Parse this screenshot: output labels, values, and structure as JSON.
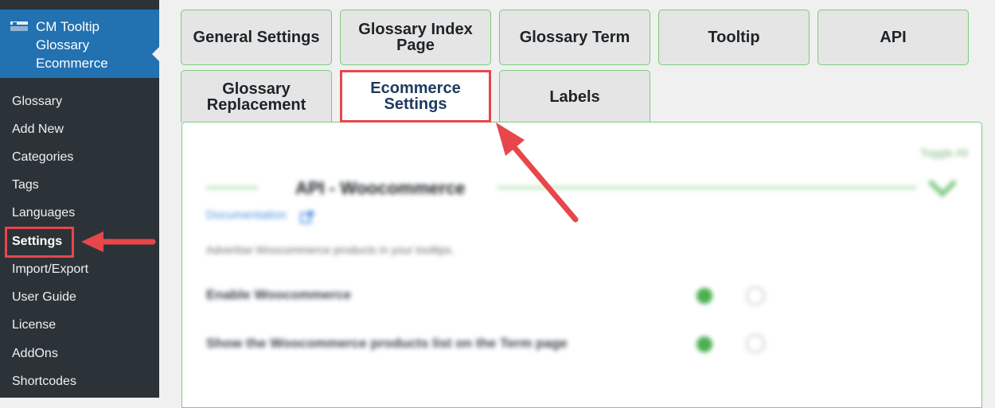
{
  "sidebar": {
    "plugin_title_lines": [
      "CM Tooltip",
      "Glossary",
      "Ecommerce"
    ],
    "items": [
      {
        "label": "Glossary",
        "current": false
      },
      {
        "label": "Add New",
        "current": false
      },
      {
        "label": "Categories",
        "current": false
      },
      {
        "label": "Tags",
        "current": false
      },
      {
        "label": "Languages",
        "current": false
      },
      {
        "label": "Settings",
        "current": true
      },
      {
        "label": "Import/Export",
        "current": false
      },
      {
        "label": "User Guide",
        "current": false
      },
      {
        "label": "License",
        "current": false
      },
      {
        "label": "AddOns",
        "current": false
      },
      {
        "label": "Shortcodes",
        "current": false
      }
    ]
  },
  "tabs": {
    "general_settings": "General Settings",
    "glossary_index_page": "Glossary Index Page",
    "glossary_term": "Glossary Term",
    "tooltip": "Tooltip",
    "api": "API",
    "glossary_replacement": "Glossary Replacement",
    "ecommerce_settings": "Ecommerce Settings",
    "labels": "Labels",
    "active": "Ecommerce Settings"
  },
  "panel": {
    "toggle_all": "Toggle All",
    "section_title": "API - Woocommerce",
    "documentation_link": "Documentation",
    "description": "Advertise Woocommerce products in your tooltips.",
    "options": [
      {
        "label": "Enable Woocommerce",
        "value": "on"
      },
      {
        "label": "Show the Woocommerce products list on the Term page",
        "value": "on"
      }
    ]
  },
  "colors": {
    "sidebar_bg": "#2c3338",
    "sidebar_header_bg": "#2271b1",
    "tab_border": "#7ccb7c",
    "highlight_red": "#e7474b",
    "radio_on": "#4caf50"
  }
}
